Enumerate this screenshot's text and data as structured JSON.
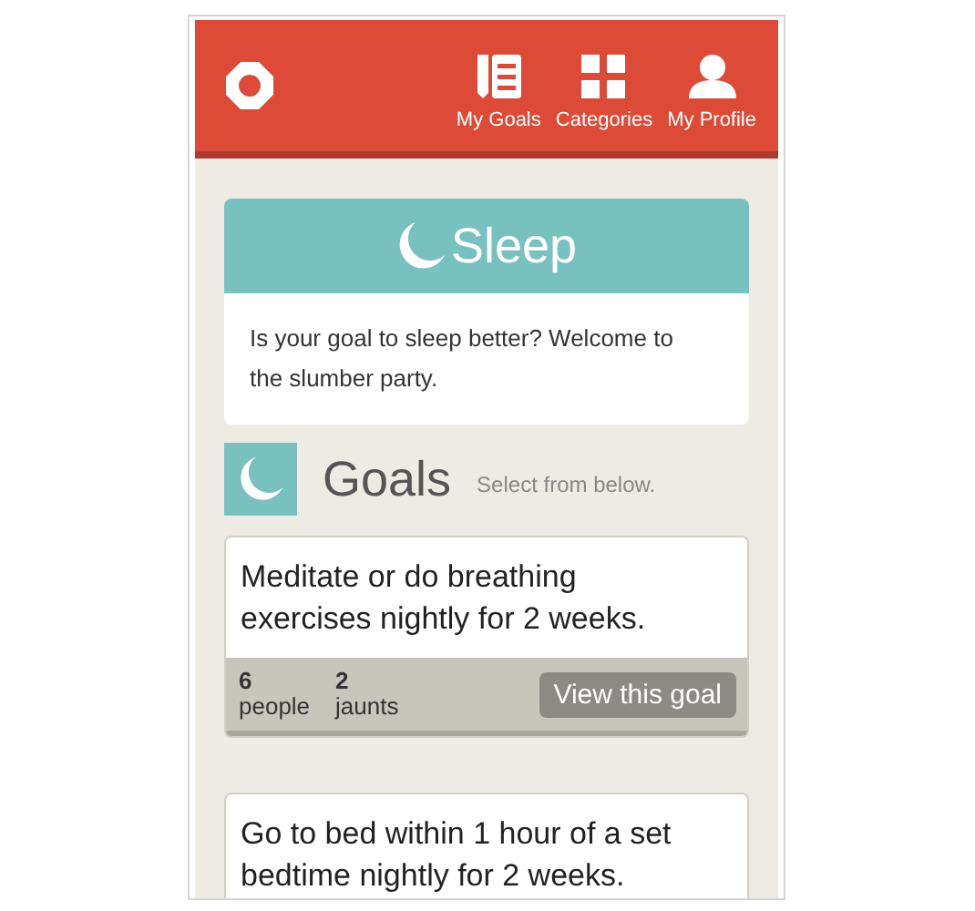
{
  "nav": [
    {
      "label": "My Goals"
    },
    {
      "label": "Categories"
    },
    {
      "label": "My Profile"
    }
  ],
  "category": {
    "title": "Sleep",
    "description": "Is your goal to sleep better? Welcome to the slumber party."
  },
  "goals_header": {
    "title": "Goals",
    "hint": "Select from below."
  },
  "goals": [
    {
      "text": "Meditate or do breathing exercises nightly for 2 weeks.",
      "people_count": "6",
      "people_label": "people",
      "jaunts_count": "2",
      "jaunts_label": "jaunts",
      "button": "View this goal"
    },
    {
      "text": "Go to bed within 1 hour of a set bedtime nightly for 2 weeks."
    }
  ]
}
